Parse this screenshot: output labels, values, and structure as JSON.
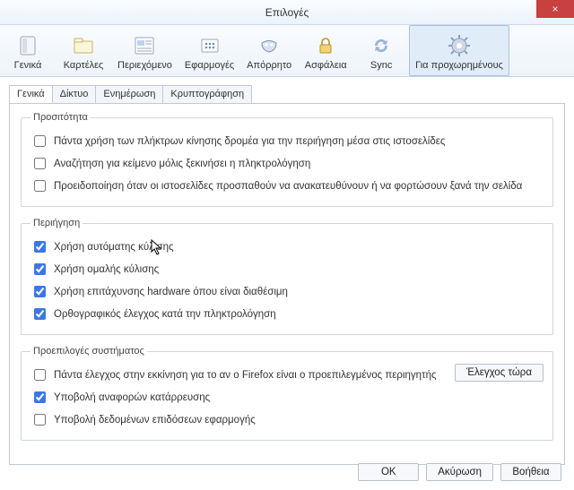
{
  "window": {
    "title": "Επιλογές",
    "close": "×"
  },
  "toolbar": {
    "items": [
      {
        "label": "Γενικά"
      },
      {
        "label": "Καρτέλες"
      },
      {
        "label": "Περιεχόμενο"
      },
      {
        "label": "Εφαρμογές"
      },
      {
        "label": "Απόρρητο"
      },
      {
        "label": "Ασφάλεια"
      },
      {
        "label": "Sync"
      },
      {
        "label": "Για προχωρημένους"
      }
    ],
    "selected": 7
  },
  "subtabs": {
    "items": [
      {
        "label": "Γενικά"
      },
      {
        "label": "Δίκτυο"
      },
      {
        "label": "Ενημέρωση"
      },
      {
        "label": "Κρυπτογράφηση"
      }
    ],
    "active": 0
  },
  "groups": {
    "accessibility": {
      "legend": "Προσιτότητα",
      "opts": [
        {
          "label": "Πάντα χρήση των πλήκτρων κίνησης δρομέα για την περιήγηση μέσα στις ιστοσελίδες",
          "checked": false
        },
        {
          "label": "Αναζήτηση για κείμενο μόλις ξεκινήσει η πληκτρολόγηση",
          "checked": false
        },
        {
          "label": "Προειδοποίηση όταν οι ιστοσελίδες προσπαθούν να ανακατευθύνουν ή να φορτώσουν ξανά την σελίδα",
          "checked": false
        }
      ]
    },
    "browsing": {
      "legend": "Περιήγηση",
      "opts": [
        {
          "label": "Χρήση αυτόματης κύλισης",
          "checked": true
        },
        {
          "label": "Χρήση ομαλής κύλισης",
          "checked": true
        },
        {
          "label": "Χρήση επιτάχυνσης hardware όπου είναι διαθέσιμη",
          "checked": true
        },
        {
          "label": "Ορθογραφικός έλεγχος κατά την πληκτρολόγηση",
          "checked": true
        }
      ]
    },
    "system": {
      "legend": "Προεπιλογές συστήματος",
      "check_now": "Έλεγχος τώρα",
      "opts": [
        {
          "label": "Πάντα έλεγχος στην εκκίνηση για το αν ο Firefox είναι ο προεπιλεγμένος περιηγητής",
          "checked": false
        },
        {
          "label": "Υποβολή αναφορών κατάρρευσης",
          "checked": true
        },
        {
          "label": "Υποβολή δεδομένων επιδόσεων εφαρμογής",
          "checked": false
        }
      ]
    }
  },
  "footer": {
    "ok": "OK",
    "cancel": "Ακύρωση",
    "help": "Βοήθεια"
  }
}
